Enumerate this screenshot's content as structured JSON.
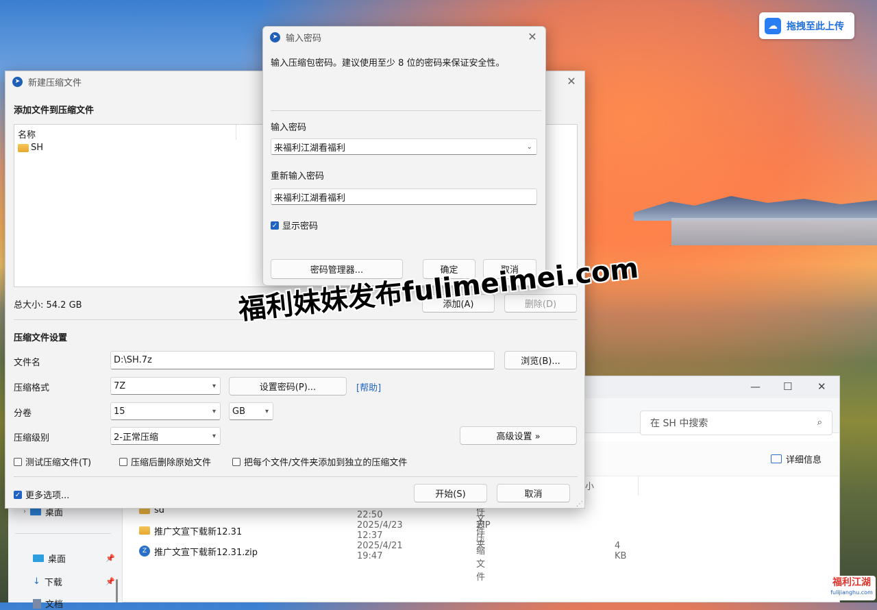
{
  "cloud_upload": {
    "label": "拖拽至此上传"
  },
  "explorer": {
    "search_placeholder": "在 SH 中搜索",
    "details_label": "详细信息",
    "column_size_partial": "小",
    "nav": {
      "desktop_partial": "桌面",
      "desktop": "桌面",
      "downloads": "下载",
      "docs_partial": "文档"
    },
    "files": [
      {
        "name": "sd",
        "date": "2025/4/21 22:50",
        "type": "文件夹",
        "size": ""
      },
      {
        "name": "推广文宣下载新12.31",
        "date": "2025/4/23 12:37",
        "type": "文件夹",
        "size": ""
      },
      {
        "name": "推广文宣下载新12.31.zip",
        "date": "2025/4/21 19:47",
        "type": "ZIP 压缩文件",
        "size": "4 KB"
      }
    ]
  },
  "new_archive": {
    "title": "新建压缩文件",
    "add_files_heading": "添加文件到压缩文件",
    "list_header": "名称",
    "list_items": [
      "SH"
    ],
    "total_size": "总大小: 54.2 GB",
    "add_button": "添加(A)",
    "delete_button": "删除(D)",
    "settings_heading": "压缩文件设置",
    "filename_label": "文件名",
    "filename_value": "D:\\SH.7z",
    "browse_button": "浏览(B)...",
    "format_label": "压缩格式",
    "format_value": "7Z",
    "set_password_button": "设置密码(P)...",
    "help_link": "[帮助]",
    "volume_label": "分卷",
    "volume_value": "15",
    "volume_unit": "GB",
    "level_label": "压缩级别",
    "level_value": "2-正常压缩",
    "advanced_button": "高级设置 »",
    "test_checkbox": "测试压缩文件(T)",
    "delete_after_checkbox": "压缩后删除原始文件",
    "separate_checkbox": "把每个文件/文件夹添加到独立的压缩文件",
    "more_options_checkbox": "更多选项...",
    "start_button": "开始(S)",
    "cancel_button": "取消"
  },
  "password_dialog": {
    "title": "输入密码",
    "description": "输入压缩包密码。建议使用至少 8 位的密码来保证安全性。",
    "password_label": "输入密码",
    "password_value": "来福利江湖看福利",
    "confirm_label": "重新输入密码",
    "confirm_value": "来福利江湖看福利",
    "show_password": "显示密码",
    "manager_button": "密码管理器...",
    "ok_button": "确定",
    "cancel_button": "取消"
  },
  "watermark": {
    "text": "福利妹妹发布fulimeimei.com"
  },
  "corner_logo": {
    "title": "福利江湖",
    "url": "fulijianghu.com"
  }
}
